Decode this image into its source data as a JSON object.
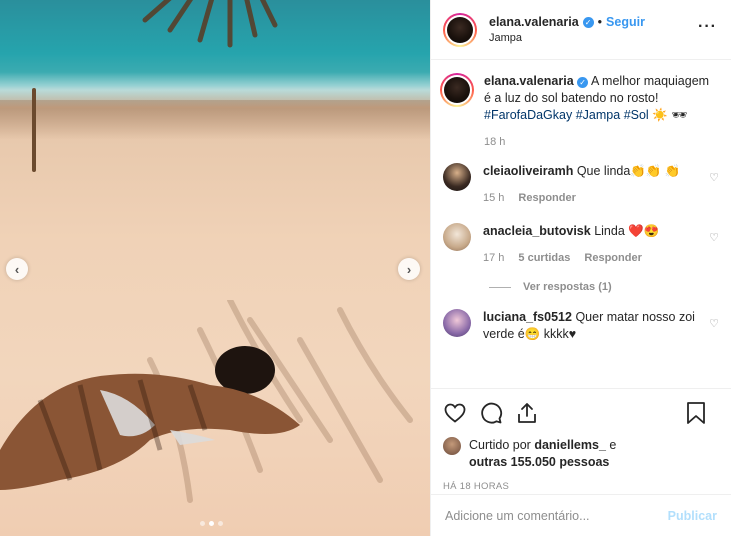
{
  "post": {
    "author": "elana.valenaria",
    "separator": "•",
    "follow_label": "Seguir",
    "location": "Jampa",
    "more_icon": "more-horizontal-icon"
  },
  "caption": {
    "username": "elana.valenaria",
    "text_plain": "A melhor maquiagem é a luz do sol batendo no rosto!",
    "hashtags": [
      "#FarofaDaGkay",
      "#Jampa",
      "#Sol"
    ],
    "emoji": "☀️ 🕶",
    "time": "18 h"
  },
  "comments": [
    {
      "username": "cleiaoliveiramh",
      "text": "Que linda👏👏 👏",
      "time": "15 h",
      "reply_label": "Responder"
    },
    {
      "username": "anacleia_butovisk",
      "text": "Linda ❤️😍",
      "time": "17 h",
      "likes": "5 curtidas",
      "reply_label": "Responder",
      "view_replies": "Ver respostas (1)"
    },
    {
      "username": "luciana_fs0512",
      "text": "Quer matar nosso zoi verde é😁 kkkk♥"
    }
  ],
  "likes": {
    "prefix": "Curtido por",
    "user": "daniellems_",
    "middle": "e",
    "others": "outras 155.050 pessoas"
  },
  "timestamp": "HÁ 18 HORAS",
  "add_comment": {
    "placeholder": "Adicione um comentário...",
    "publish_label": "Publicar"
  },
  "carousel": {
    "total_images": 3,
    "active_index": 1,
    "prev_icon": "chevron-left-icon",
    "next_icon": "chevron-right-icon"
  },
  "colors": {
    "link_blue": "#3897f0",
    "hashtag": "#003569",
    "muted": "#8e8e8e",
    "publish_disabled": "#b2dffc"
  }
}
